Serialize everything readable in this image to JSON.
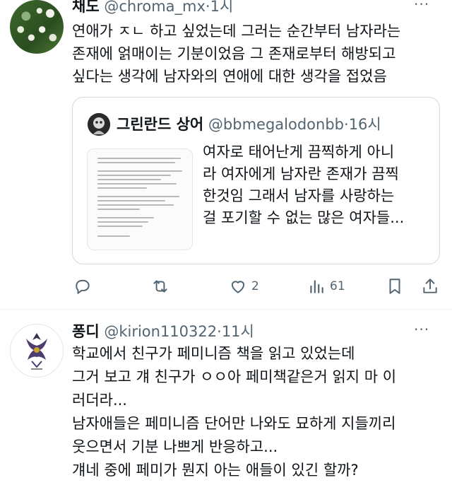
{
  "tweet1": {
    "display_name": "채도",
    "handle": "@chroma_mx",
    "separator": "·",
    "time": "1시",
    "more": "···",
    "lines": [
      "연애가 ㅈㄴ 하고 싶었는데 그러는 순간부터 남자라는",
      "존재에 얽매이는 기분이었음 그 존재로부터 해방되고",
      "싶다는 생각에 남자와의 연애에 대한 생각을 접었음"
    ],
    "quote": {
      "display_name": "그린란드 상어",
      "handle": "@bbmegalodonbb",
      "separator": "·",
      "time": "16시",
      "lines": [
        "여자로 태어난게 끔찍하게 아니",
        "라 여자에게 남자란 존재가 끔찍",
        "한것임 그래서 남자를 사랑하는",
        "걸 포기할 수 없는 많은 여자들..."
      ]
    },
    "actions": {
      "reply_count": "",
      "retweet_count": "",
      "like_count": "2",
      "views_count": "61"
    }
  },
  "tweet2": {
    "display_name": "퐁디",
    "handle": "@kirion110322",
    "separator": "·",
    "time": "11시",
    "more": "···",
    "lines": [
      "학교에서 친구가 페미니즘 책을 읽고 있었는데",
      "그거 보고 걔 친구가 ㅇㅇ아 페미책같은거 읽지 마 이",
      "러더라...",
      "남자애들은 페미니즘 단어만 나와도 묘하게 지들끼리",
      "웃으면서 기분 나쁘게 반응하고...",
      "걔네 중에 페미가 뭔지 아는 애들이 있긴 할까?"
    ]
  },
  "colors": {
    "text": "#0f1419",
    "secondary": "#536471",
    "border": "#cfd9de"
  }
}
